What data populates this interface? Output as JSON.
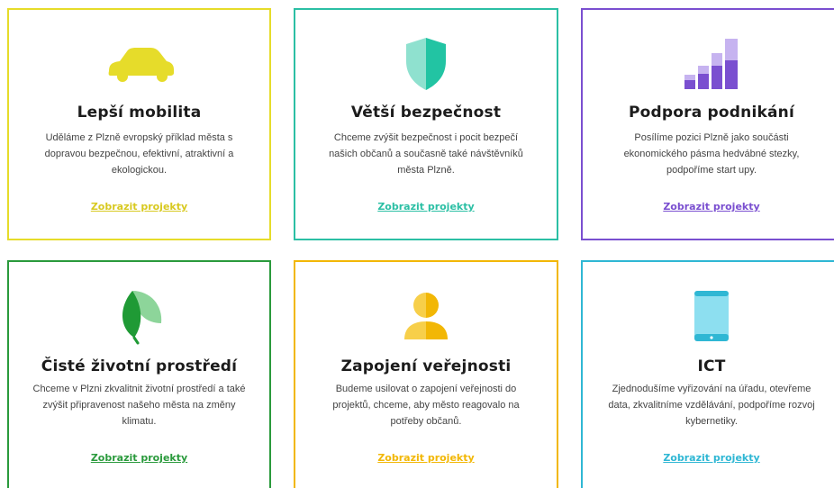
{
  "cards": [
    {
      "title": "Lepší mobilita",
      "description": "Uděláme z Plzně evropský příklad města s dopravou bezpečnou, efektivní, atraktivní a ekologickou.",
      "link": "Zobrazit projekty",
      "icon": "car-icon",
      "color": "#e6dc2a"
    },
    {
      "title": "Větší bezpečnost",
      "description": "Chceme zvýšit bezpečnost i pocit bezpečí našich občanů a současně také návštěvníků města Plzně.",
      "link": "Zobrazit projekty",
      "icon": "shield-icon",
      "color": "#2bbfa4"
    },
    {
      "title": "Podpora podnikání",
      "description": "Posílíme pozici Plzně jako součásti ekonomického pásma hedvábné stezky, podpoříme start upy.",
      "link": "Zobrazit projekty",
      "icon": "bar-growth-icon",
      "color": "#7a4fd0"
    },
    {
      "title": "Čisté životní prostředí",
      "description": "Chceme v Plzni zkvalitnit životní prostředí a také zvýšit připravenost našeho města na změny klimatu.",
      "link": "Zobrazit projekty",
      "icon": "leaf-icon",
      "color": "#2a9a3c"
    },
    {
      "title": "Zapojení veřejnosti",
      "description": "Budeme usilovat o zapojení veřejnosti do projektů, chceme, aby město reagovalo na potřeby občanů.",
      "link": "Zobrazit projekty",
      "icon": "person-icon",
      "color": "#f2b705"
    },
    {
      "title": "ICT",
      "description": "Zjednodušíme vyřizování na úřadu, otevřeme data, zkvalitníme vzdělávání, podpoříme rozvoj kybernetiky.",
      "link": "Zobrazit projekty",
      "icon": "tablet-icon",
      "color": "#2fb7d4"
    }
  ]
}
